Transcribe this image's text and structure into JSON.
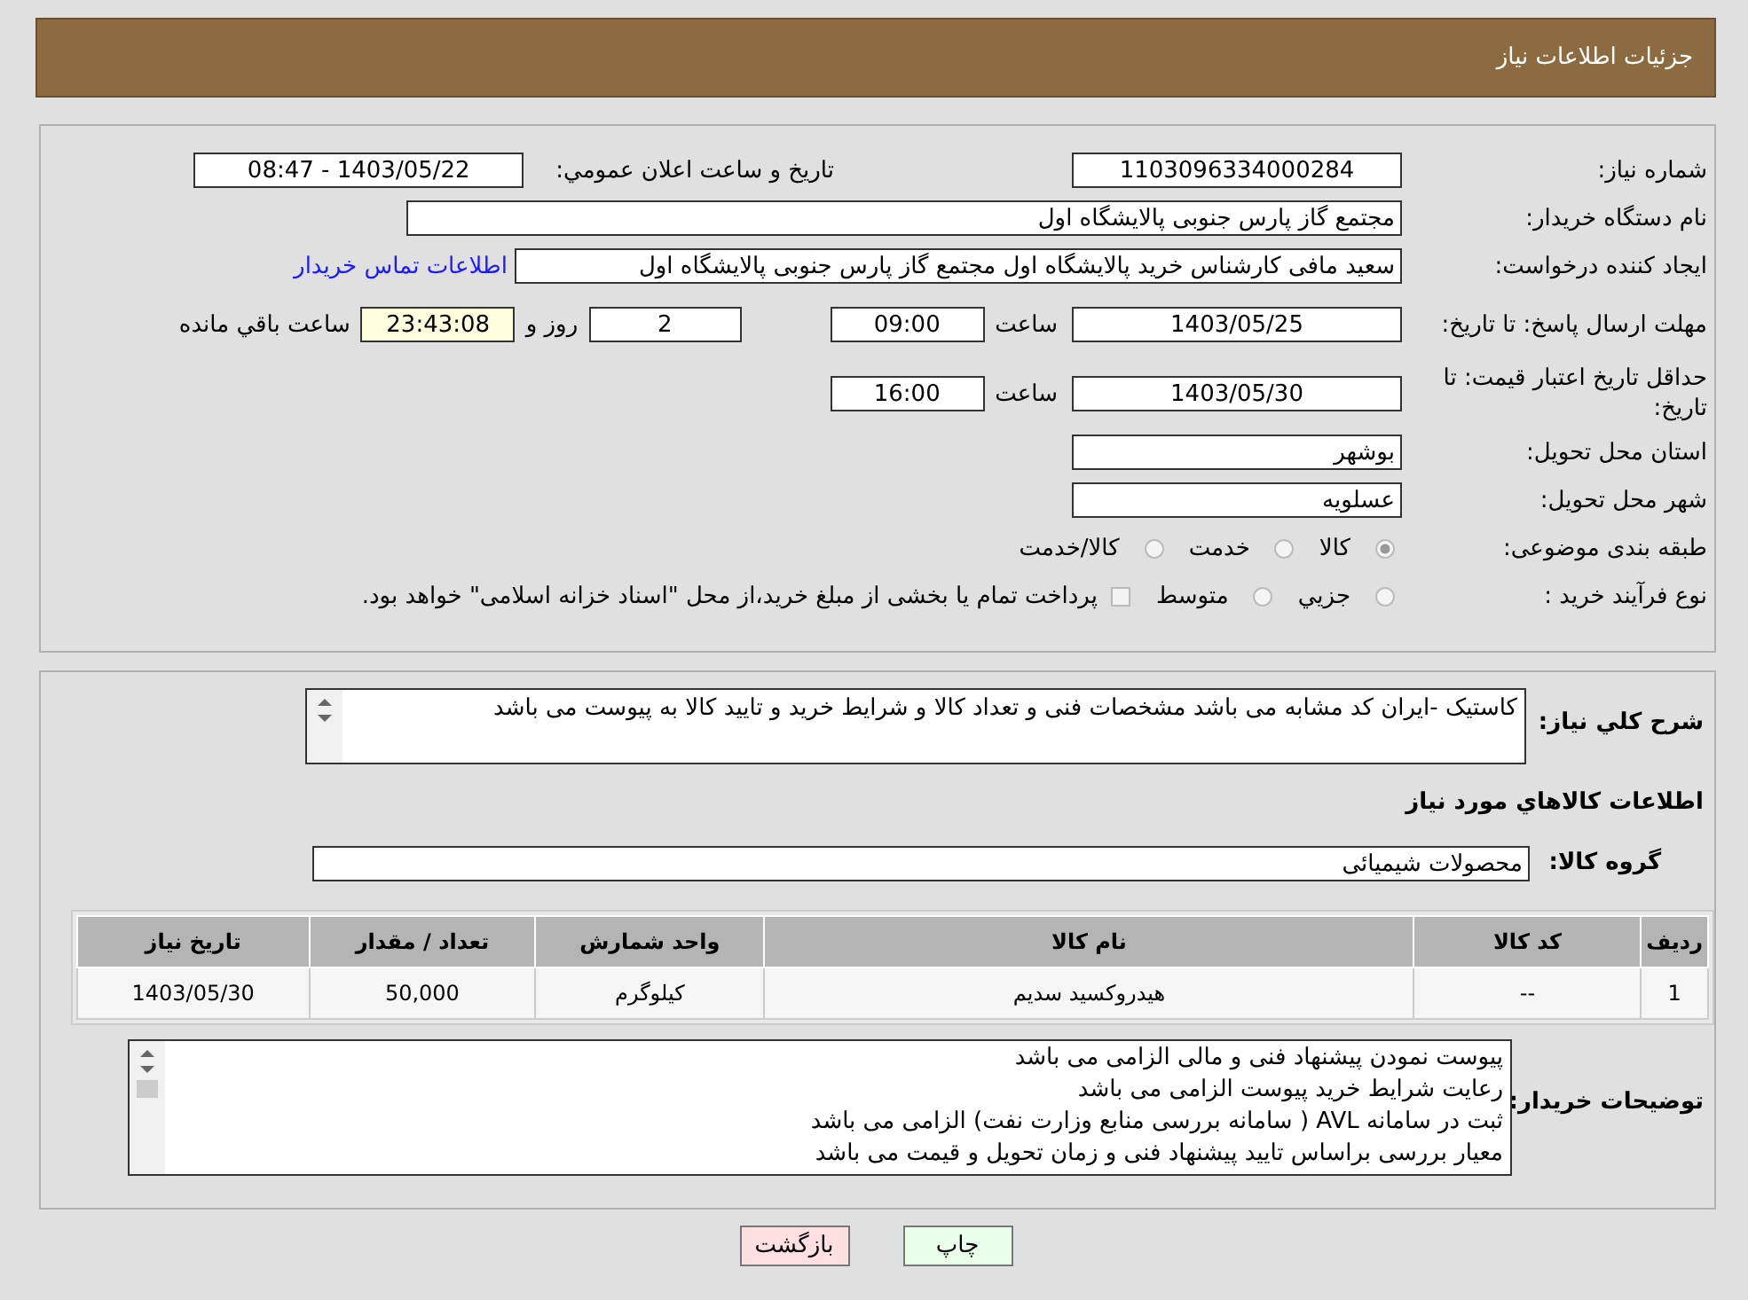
{
  "header": {
    "title": "جزئیات اطلاعات نیاز"
  },
  "need_number": {
    "label": "شماره نیاز:",
    "value": "1103096334000284"
  },
  "announce": {
    "label": "تاریخ و ساعت اعلان عمومي:",
    "value": "1403/05/22 - 08:47"
  },
  "buyer_org": {
    "label": "نام دستگاه خریدار:",
    "value": "مجتمع گاز پارس جنوبی  پالایشگاه اول"
  },
  "requester": {
    "label": "ایجاد کننده درخواست:",
    "value": "سعید مافی کارشناس خرید پالایشگاه اول مجتمع گاز پارس جنوبی  پالایشگاه اول",
    "link": "اطلاعات تماس خریدار"
  },
  "reply_deadline": {
    "label": "مهلت ارسال پاسخ: تا تاریخ:",
    "date": "1403/05/25",
    "time_label": "ساعت",
    "time": "09:00",
    "days": "2",
    "days_label": "روز و",
    "remaining": "23:43:08",
    "remaining_label": "ساعت باقي مانده"
  },
  "price_validity": {
    "label": "حداقل تاریخ اعتبار قیمت: تا تاریخ:",
    "date": "1403/05/30",
    "time_label": "ساعت",
    "time": "16:00"
  },
  "province": {
    "label": "استان محل تحویل:",
    "value": "بوشهر"
  },
  "city": {
    "label": "شهر محل تحویل:",
    "value": "عسلویه"
  },
  "category": {
    "label": "طبقه بندی موضوعی:",
    "options": [
      {
        "label": "کالا",
        "selected": true
      },
      {
        "label": "خدمت",
        "selected": false
      },
      {
        "label": "کالا/خدمت",
        "selected": false
      }
    ]
  },
  "purchase_type": {
    "label": "نوع فرآیند خرید :",
    "options": [
      {
        "label": "جزيي",
        "selected": false
      },
      {
        "label": "متوسط",
        "selected": false
      }
    ],
    "treasury": {
      "label": "پرداخت تمام یا بخشی از مبلغ خرید،از محل \"اسناد خزانه اسلامی\" خواهد بود.",
      "checked": false
    }
  },
  "description": {
    "label": "شرح کلي نیاز:",
    "text": "کاستیک -ایران کد مشابه می باشد مشخصات فنی و تعداد کالا و شرایط خرید و تایید کالا  به پیوست می باشد"
  },
  "goods_heading": "اطلاعات کالاهاي مورد نیاز",
  "goods_group": {
    "label": "گروه کالا:",
    "value": "محصولات شیمیائی"
  },
  "table": {
    "columns": [
      "ردیف",
      "کد کالا",
      "نام کالا",
      "واحد شمارش",
      "تعداد / مقدار",
      "تاریخ نیاز"
    ],
    "rows": [
      [
        "1",
        "--",
        "هیدروکسید سدیم",
        "کیلوگرم",
        "50,000",
        "1403/05/30"
      ]
    ]
  },
  "buyer_notes": {
    "label": "توضیحات خریدار:",
    "lines": [
      "پیوست نمودن پیشنهاد فنی و مالی الزامی می باشد",
      "رعایت شرایط خرید پیوست الزامی می باشد",
      "ثبت در سامانه AVL ( سامانه بررسی منابع وزارت نفت) الزامی می باشد",
      "معیار بررسی براساس تایید پیشنهاد فنی و زمان تحویل و قیمت می باشد"
    ]
  },
  "buttons": [
    {
      "label": "چاپ",
      "kind": "print"
    },
    {
      "label": "بازگشت",
      "kind": "back"
    }
  ]
}
